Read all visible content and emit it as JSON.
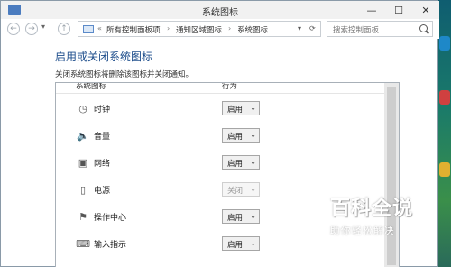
{
  "window": {
    "title": "系统图标"
  },
  "titlebar_buttons": {
    "minimize": "—",
    "maximize": "☐",
    "close": "✕"
  },
  "nav": {
    "back": "←",
    "forward": "→",
    "up": "↑",
    "dropdown": "▾"
  },
  "breadcrumb": {
    "root": "«",
    "items": [
      "所有控制面板项",
      "通知区域图标",
      "系统图标"
    ],
    "separator": "›",
    "dropdown": "▾",
    "refresh": "⟳"
  },
  "search": {
    "placeholder": "搜索控制面板"
  },
  "page": {
    "title": "启用或关闭系统图标",
    "description": "关闭系统图标将删除该图标并关闭通知。"
  },
  "table": {
    "headers": {
      "icon": "系统图标",
      "behavior": "行为"
    },
    "rows": [
      {
        "icon": "clock-icon",
        "glyph": "◷",
        "name": "时钟",
        "value": "启用",
        "enabled": true
      },
      {
        "icon": "volume-icon",
        "glyph": "🔈",
        "name": "音量",
        "value": "启用",
        "enabled": true
      },
      {
        "icon": "network-icon",
        "glyph": "▣",
        "name": "网络",
        "value": "启用",
        "enabled": true
      },
      {
        "icon": "power-icon",
        "glyph": "▯",
        "name": "电源",
        "value": "关闭",
        "enabled": false
      },
      {
        "icon": "action-center-icon",
        "glyph": "⚑",
        "name": "操作中心",
        "value": "启用",
        "enabled": true
      },
      {
        "icon": "input-indicator-icon",
        "glyph": "⌨",
        "name": "输入指示",
        "value": "启用",
        "enabled": true
      }
    ]
  },
  "watermark": {
    "title": "百科全说",
    "subtitle": "助你轻松解决"
  }
}
